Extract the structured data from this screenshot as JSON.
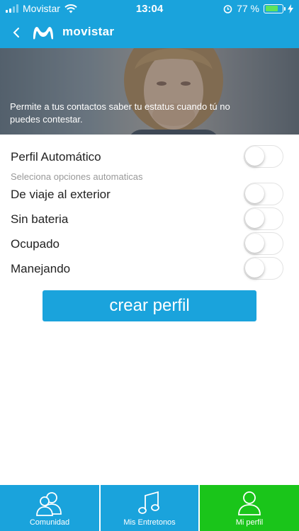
{
  "status_bar": {
    "carrier": "Movistar",
    "time": "13:04",
    "battery_percent": "77 %",
    "battery_level": 0.77
  },
  "header": {
    "brand": "movistar",
    "back_icon": "chevron-left-icon",
    "logo_icon": "movistar-m-logo"
  },
  "hero": {
    "caption": "Permite a tus contactos saber tu estatus cuando tú no puedes contestar."
  },
  "profile": {
    "auto_label": "Perfil Automático",
    "auto_on": false,
    "options_hint": "Seleciona opciones automaticas",
    "options": [
      {
        "label": "De viaje al exterior",
        "on": false
      },
      {
        "label": "Sin bateria",
        "on": false
      },
      {
        "label": "Ocupado",
        "on": false
      },
      {
        "label": "Manejando",
        "on": false
      }
    ],
    "create_label": "crear perfil"
  },
  "tabs": [
    {
      "label": "Comunidad",
      "icon": "community-icon",
      "active": false
    },
    {
      "label": "Mis Entretonos",
      "icon": "music-note-icon",
      "active": false
    },
    {
      "label": "Mi perfil",
      "icon": "profile-icon",
      "active": true
    }
  ],
  "colors": {
    "brand_blue": "#1aa3dc",
    "active_tab": "#1ac51a"
  }
}
